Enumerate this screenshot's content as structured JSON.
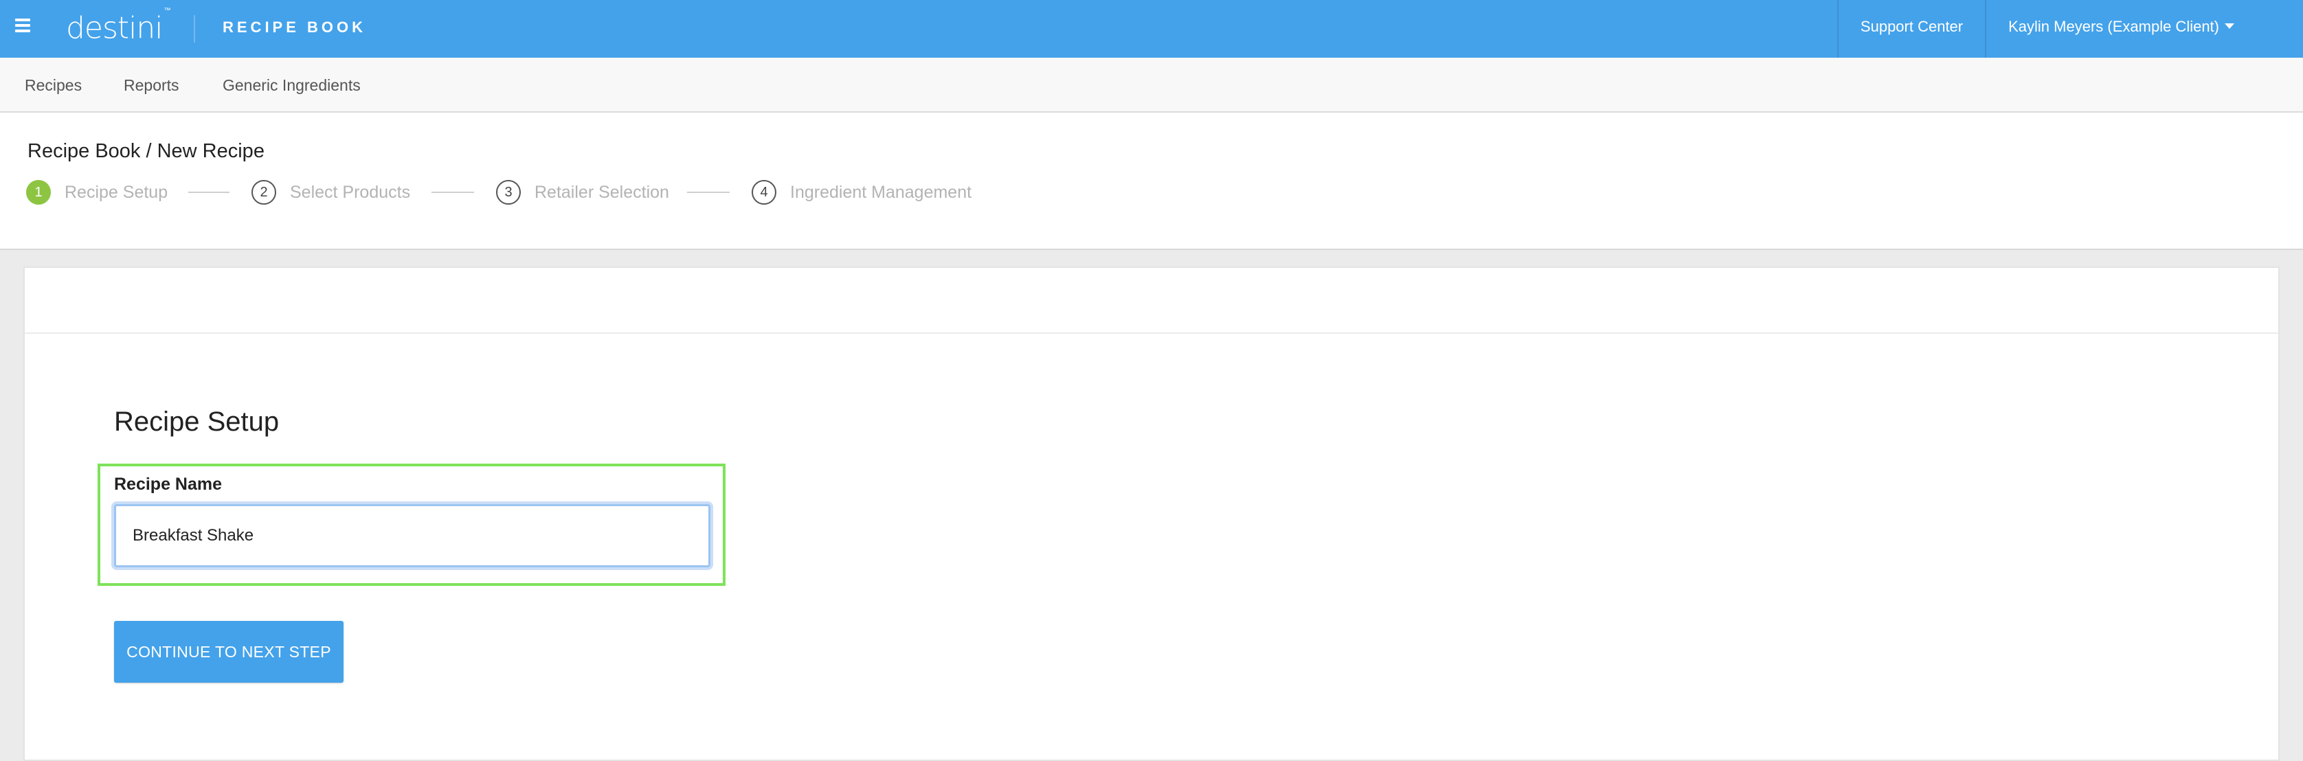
{
  "topbar": {
    "logo_text": "destini",
    "logo_tm": "™",
    "app_title": "RECIPE BOOK",
    "support_label": "Support Center",
    "user_label": "Kaylin Meyers (Example Client)"
  },
  "subnav": {
    "items": [
      {
        "label": "Recipes"
      },
      {
        "label": "Reports"
      },
      {
        "label": "Generic Ingredients"
      }
    ]
  },
  "header": {
    "breadcrumb": "Recipe Book / New Recipe",
    "steps": [
      {
        "number": "1",
        "label": "Recipe Setup",
        "active": true
      },
      {
        "number": "2",
        "label": "Select Products",
        "active": false
      },
      {
        "number": "3",
        "label": "Retailer Selection",
        "active": false
      },
      {
        "number": "4",
        "label": "Ingredient Management",
        "active": false
      }
    ]
  },
  "form": {
    "section_title": "Recipe Setup",
    "recipe_name_label": "Recipe Name",
    "recipe_name_value": "Breakfast Shake",
    "continue_label": "CONTINUE TO NEXT STEP"
  },
  "colors": {
    "brand_blue": "#44a2ea",
    "step_active_green": "#8dc542",
    "highlight_green": "#7ee25a"
  },
  "icons": {
    "menu": "hamburger-menu-icon",
    "user_dropdown": "caret-down-icon"
  }
}
